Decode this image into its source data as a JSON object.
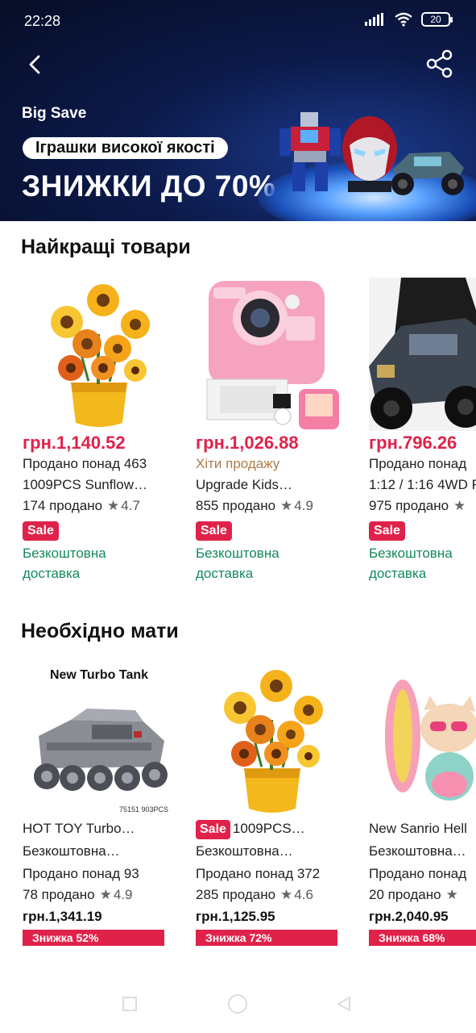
{
  "status_bar": {
    "time": "22:28",
    "battery": "20"
  },
  "header": {
    "back_icon": "chevron-left-icon",
    "share_icon": "share-icon"
  },
  "banner": {
    "tag": "Big Save",
    "pill": "Іграшки високої якості",
    "headline": "ЗНИЖКИ ДО 70%"
  },
  "best_section": {
    "title": "Найкращі товари",
    "items": [
      {
        "image": "sunflower-bouquet-image",
        "price": "грн.1,140.52",
        "subtitle": "Продано понад 463",
        "name": "1009PCS Sunflow…",
        "sold": "174 продано",
        "rating": "4.7",
        "badge": "Sale",
        "shipping": "Безкоштовна доставка"
      },
      {
        "image": "pink-kids-camera-image",
        "price": "грн.1,026.88",
        "subtitle": "Хіти продажу",
        "name": "Upgrade Kids…",
        "sold": "855 продано",
        "rating": "4.9",
        "badge": "Sale",
        "shipping": "Безкоштовна доставка"
      },
      {
        "image": "rc-car-image",
        "price": "грн.796.26",
        "subtitle": "Продано понад",
        "name": "1:12 / 1:16 4WD R",
        "sold": "975 продано",
        "rating": "",
        "badge": "Sale",
        "shipping": "Безкоштовна доставка"
      }
    ]
  },
  "need_section": {
    "title": "Необхідно мати",
    "items": [
      {
        "image": "turbo-tank-image",
        "image_caption": "New Turbo Tank",
        "image_code": "75151 903PCS",
        "name": "HOT TOY Turbo…",
        "name_badge": "",
        "shipping": "Безкоштовна…",
        "subtitle": "Продано понад 93",
        "sold": "78 продано",
        "rating": "4.9",
        "price": "грн.1,341.19",
        "discount": "Знижка 52%"
      },
      {
        "image": "sunflower-bouquet-image",
        "image_caption": "",
        "image_code": "",
        "name": "1009PCS…",
        "name_badge": "Sale",
        "shipping": "Безкоштовна…",
        "subtitle": "Продано понад 372",
        "sold": "285 продано",
        "rating": "4.6",
        "price": "грн.1,125.95",
        "discount": "Знижка 72%"
      },
      {
        "image": "hello-kitty-toy-image",
        "image_caption": "",
        "image_code": "",
        "name": "New Sanrio Hell",
        "name_badge": "",
        "shipping": "Безкоштовна…",
        "subtitle": "Продано понад",
        "sold": "20 продано",
        "rating": "",
        "price": "грн.2,040.95",
        "discount": "Знижка 68%"
      }
    ]
  },
  "colors": {
    "accent_red": "#e0224a",
    "ship_green": "#138a5a",
    "banner_dark": "#070d26"
  }
}
